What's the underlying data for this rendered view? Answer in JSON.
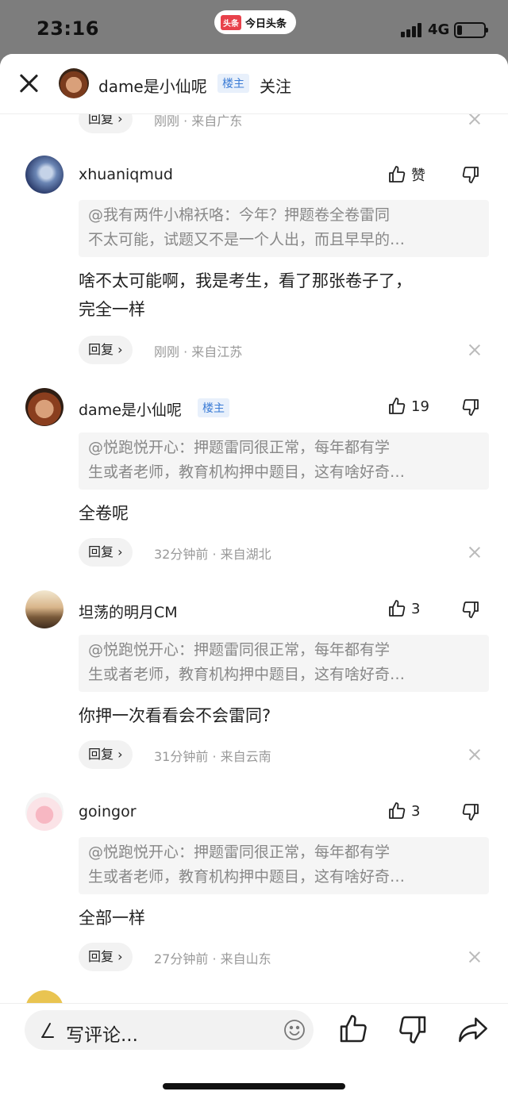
{
  "status_bar": {
    "time": "23:16",
    "app_logo": "头条",
    "app_name": "今日头条",
    "network": "4G",
    "battery_level": 0.2
  },
  "header": {
    "username": "dame是小仙呢",
    "badge": "楼主",
    "follow_label": "关注"
  },
  "top_partial": {
    "reply_label": "回复",
    "meta": "刚刚 · 来自广东"
  },
  "comments": [
    {
      "username": "xhuaniqmud",
      "like_label": "赞",
      "quote_line1": "@我有两件小棉袄咯：今年？押题卷全卷雷同",
      "quote_line2": "不太可能，试题又不是一个人出，而且早早的…",
      "body_line1": "啥不太可能啊，我是考生，看了那张卷子了，",
      "body_line2": "完全一样",
      "reply_label": "回复",
      "meta": "刚刚 · 来自江苏"
    },
    {
      "username": "dame是小仙呢",
      "badge": "楼主",
      "like_label": "19",
      "quote_line1": "@悦跑悦开心：押题雷同很正常，每年都有学",
      "quote_line2": "生或者老师，教育机构押中题目，这有啥好奇…",
      "body_line1": "全卷呢",
      "reply_label": "回复",
      "meta": "32分钟前 · 来自湖北"
    },
    {
      "username": "坦荡的明月CM",
      "like_label": "3",
      "quote_line1": "@悦跑悦开心：押题雷同很正常，每年都有学",
      "quote_line2": "生或者老师，教育机构押中题目，这有啥好奇…",
      "body_line1": "你押一次看看会不会雷同?",
      "reply_label": "回复",
      "meta": "31分钟前 · 来自云南"
    },
    {
      "username": "goingor",
      "like_label": "3",
      "quote_line1": "@悦跑悦开心：押题雷同很正常，每年都有学",
      "quote_line2": "生或者老师，教育机构押中题目，这有啥好奇…",
      "body_line1": "全部一样",
      "reply_label": "回复",
      "meta": "27分钟前 · 来自山东"
    }
  ],
  "bottom_bar": {
    "write_placeholder": "写评论...",
    "icons": [
      "pen-icon",
      "emoji-icon",
      "like-icon",
      "dislike-icon",
      "share-icon"
    ]
  }
}
